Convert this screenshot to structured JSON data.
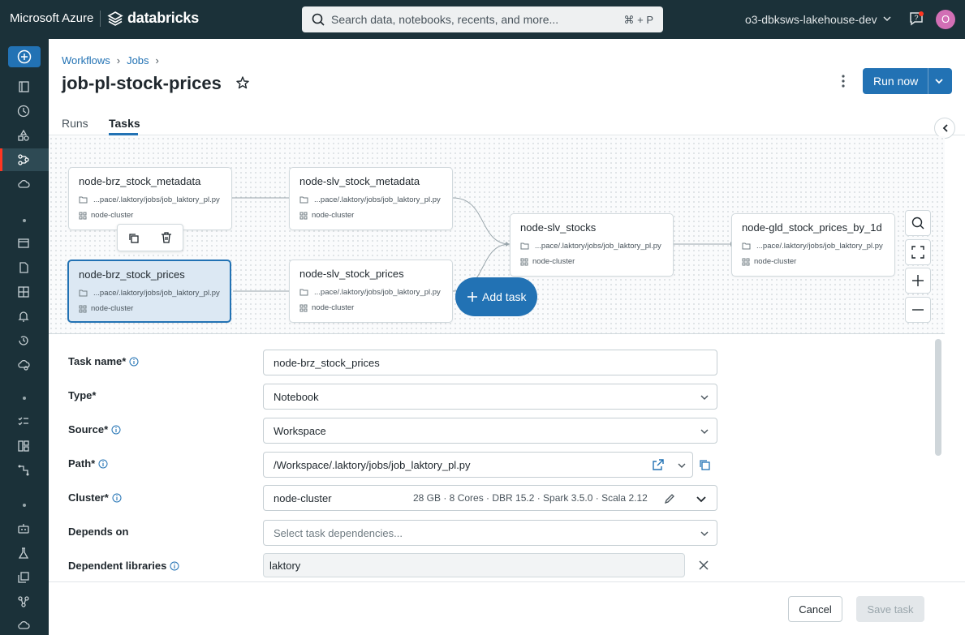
{
  "topbar": {
    "brand": "Microsoft Azure",
    "product": "databricks",
    "search_placeholder": "Search data, notebooks, recents, and more...",
    "search_shortcut": "⌘ + P",
    "workspace": "o3-dbksws-lakehouse-dev",
    "avatar_initial": "O"
  },
  "breadcrumb": {
    "workflows": "Workflows",
    "jobs": "Jobs"
  },
  "page": {
    "title": "job-pl-stock-prices",
    "run_now": "Run now"
  },
  "tabs": {
    "runs": "Runs",
    "tasks": "Tasks"
  },
  "nodes": [
    {
      "name": "node-brz_stock_metadata",
      "path": "...pace/.laktory/jobs/job_laktory_pl.py",
      "cluster": "node-cluster"
    },
    {
      "name": "node-slv_stock_metadata",
      "path": "...pace/.laktory/jobs/job_laktory_pl.py",
      "cluster": "node-cluster"
    },
    {
      "name": "node-brz_stock_prices",
      "path": "...pace/.laktory/jobs/job_laktory_pl.py",
      "cluster": "node-cluster"
    },
    {
      "name": "node-slv_stock_prices",
      "path": "...pace/.laktory/jobs/job_laktory_pl.py",
      "cluster": "node-cluster"
    },
    {
      "name": "node-slv_stocks",
      "path": "...pace/.laktory/jobs/job_laktory_pl.py",
      "cluster": "node-cluster"
    },
    {
      "name": "node-gld_stock_prices_by_1d",
      "path": "...pace/.laktory/jobs/job_laktory_pl.py",
      "cluster": "node-cluster"
    }
  ],
  "add_task": "Add task",
  "form": {
    "task_name_label": "Task name*",
    "task_name_value": "node-brz_stock_prices",
    "type_label": "Type*",
    "type_value": "Notebook",
    "source_label": "Source*",
    "source_value": "Workspace",
    "path_label": "Path*",
    "path_value": "/Workspace/.laktory/jobs/job_laktory_pl.py",
    "cluster_label": "Cluster*",
    "cluster_value": "node-cluster",
    "cluster_meta": "28 GB · 8 Cores · DBR 15.2 · Spark 3.5.0 · Scala 2.12",
    "depends_label": "Depends on",
    "depends_placeholder": "Select task dependencies...",
    "libraries_label": "Dependent libraries",
    "library_value": "laktory"
  },
  "footer": {
    "cancel": "Cancel",
    "save": "Save task"
  },
  "colors": {
    "topbar": "#1b3139",
    "accent": "#2272b4",
    "active_marker": "#ff3621"
  }
}
